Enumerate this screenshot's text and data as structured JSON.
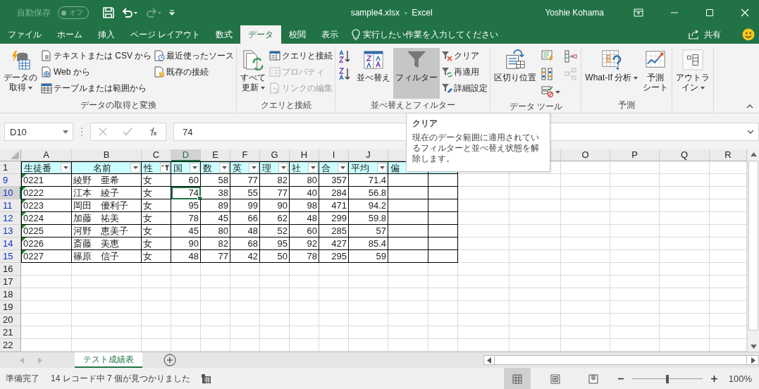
{
  "title_bar": {
    "autosave_label": "自動保存",
    "autosave_toggle": {
      "text": "オフ",
      "on": false
    },
    "title": "sample4.xlsx  -  Excel",
    "user": "Yoshie Kohama"
  },
  "ribbon_tabs": [
    {
      "label": "ファイル",
      "selected": false
    },
    {
      "label": "ホーム",
      "selected": false
    },
    {
      "label": "挿入",
      "selected": false
    },
    {
      "label": "ページ レイアウト",
      "selected": false
    },
    {
      "label": "数式",
      "selected": false
    },
    {
      "label": "データ",
      "selected": true
    },
    {
      "label": "校閲",
      "selected": false
    },
    {
      "label": "表示",
      "selected": false
    }
  ],
  "tell_me": "実行したい作業を入力してください",
  "share": "共有",
  "ribbon_groups": [
    {
      "label": "データの取得と変換",
      "columns": [
        [
          {
            "kind": "large",
            "lines": [
              "データの",
              "取得"
            ],
            "dropdown": true,
            "disabled": false
          }
        ],
        [
          {
            "kind": "small",
            "label": "テキストまたは CSV から",
            "disabled": false
          },
          {
            "kind": "small",
            "label": "Web から",
            "disabled": false
          },
          {
            "kind": "small",
            "label": "テーブルまたは範囲から",
            "disabled": false
          }
        ],
        [
          {
            "kind": "small",
            "label": "最近使ったソース",
            "disabled": false
          },
          {
            "kind": "small",
            "label": "既存の接続",
            "disabled": false
          }
        ]
      ]
    },
    {
      "label": "クエリと接続",
      "columns": [
        [
          {
            "kind": "large",
            "lines": [
              "すべて",
              "更新"
            ],
            "dropdown": true,
            "disabled": false
          }
        ],
        [
          {
            "kind": "small",
            "label": "クエリと接続",
            "disabled": false
          },
          {
            "kind": "small",
            "label": "プロパティ",
            "disabled": true
          },
          {
            "kind": "small",
            "label": "リンクの編集",
            "disabled": true
          }
        ]
      ]
    },
    {
      "label": "並べ替えとフィルター",
      "columns": [
        [
          {
            "kind": "icon",
            "disabled": false
          },
          {
            "kind": "icon",
            "disabled": false
          }
        ],
        [
          {
            "kind": "large",
            "lines": [
              "並べ替え"
            ],
            "dropdown": false,
            "disabled": false
          }
        ],
        [
          {
            "kind": "large",
            "lines": [
              "フィルター"
            ],
            "dropdown": false,
            "disabled": false,
            "pressed": true
          }
        ],
        [
          {
            "kind": "small",
            "label": "クリア",
            "disabled": false
          },
          {
            "kind": "small",
            "label": "再適用",
            "disabled": false
          },
          {
            "kind": "small",
            "label": "詳細設定",
            "disabled": false
          }
        ]
      ]
    },
    {
      "label": "データ ツール",
      "columns": [
        [
          {
            "kind": "large",
            "lines": [
              "区切り位置"
            ],
            "dropdown": false,
            "disabled": false
          }
        ],
        [
          {
            "kind": "icon",
            "disabled": false
          },
          {
            "kind": "icon",
            "disabled": false
          },
          {
            "kind": "icon",
            "disabled": false
          }
        ],
        [
          {
            "kind": "icon",
            "disabled": false
          },
          {
            "kind": "icon",
            "disabled": true
          }
        ]
      ]
    },
    {
      "label": "予測",
      "columns": [
        [
          {
            "kind": "large",
            "lines": [
              "What-If 分析"
            ],
            "dropdown": true,
            "disabled": false
          }
        ],
        [
          {
            "kind": "large",
            "lines": [
              "予測",
              "シート"
            ],
            "dropdown": false,
            "disabled": false
          }
        ]
      ]
    },
    {
      "columns": [
        [
          {
            "kind": "large",
            "lines": [
              "アウトラ",
              "イン"
            ],
            "dropdown": true,
            "disabled": false
          }
        ]
      ]
    }
  ],
  "name_box": "D10",
  "formula": "74",
  "tooltip": {
    "title": "クリア",
    "text": "現在のデータ範囲に適用されているフィルターと並べ替え状態を解除します。"
  },
  "columns": [
    {
      "letter": "A",
      "selected": false
    },
    {
      "letter": "B",
      "selected": false
    },
    {
      "letter": "C",
      "selected": false
    },
    {
      "letter": "D",
      "selected": true
    },
    {
      "letter": "E",
      "selected": false
    },
    {
      "letter": "F",
      "selected": false
    },
    {
      "letter": "G",
      "selected": false
    },
    {
      "letter": "H",
      "selected": false
    },
    {
      "letter": "I",
      "selected": false
    },
    {
      "letter": "J",
      "selected": false
    }
  ],
  "columns_right": [
    {
      "letter": "O",
      "selected": false
    },
    {
      "letter": "P",
      "selected": false
    },
    {
      "letter": "Q",
      "selected": false
    },
    {
      "letter": "R",
      "selected": false
    }
  ],
  "header_row": {
    "number": "1",
    "cells": [
      {
        "text": "生徒番",
        "kind": "text",
        "filtered": false
      },
      {
        "text": "名前",
        "kind": "text",
        "filtered": false
      },
      {
        "text": "性",
        "kind": "text",
        "filtered": true
      },
      {
        "text": "国",
        "kind": "number",
        "filtered": false
      },
      {
        "text": "数",
        "kind": "number",
        "filtered": false
      },
      {
        "text": "英",
        "kind": "number",
        "filtered": false
      },
      {
        "text": "理",
        "kind": "number",
        "filtered": false
      },
      {
        "text": "社",
        "kind": "number",
        "filtered": false
      },
      {
        "text": "合",
        "kind": "number",
        "filtered": false
      },
      {
        "text": "平均",
        "kind": "number",
        "filtered": false
      },
      {
        "text": "偏"
      }
    ]
  },
  "rows": [
    {
      "number": "9",
      "filtered": true,
      "selected": false,
      "flagged": true,
      "cells": [
        {
          "text": "0221",
          "selected": false
        },
        {
          "text": "綾野　亜希",
          "selected": false
        },
        {
          "text": "女",
          "selected": false
        },
        {
          "text": "60",
          "selected": false
        },
        {
          "text": "58",
          "selected": false
        },
        {
          "text": "77",
          "selected": false
        },
        {
          "text": "82",
          "selected": false
        },
        {
          "text": "80",
          "selected": false
        },
        {
          "text": "357",
          "selected": false
        },
        {
          "text": "71.4",
          "selected": false
        }
      ]
    },
    {
      "number": "10",
      "filtered": true,
      "selected": true,
      "flagged": true,
      "cells": [
        {
          "text": "0222",
          "selected": false
        },
        {
          "text": "江本　綾子",
          "selected": false
        },
        {
          "text": "女",
          "selected": false
        },
        {
          "text": "74",
          "selected": true
        },
        {
          "text": "38",
          "selected": false
        },
        {
          "text": "55",
          "selected": false
        },
        {
          "text": "77",
          "selected": false
        },
        {
          "text": "40",
          "selected": false
        },
        {
          "text": "284",
          "selected": false
        },
        {
          "text": "56.8",
          "selected": false
        }
      ]
    },
    {
      "number": "11",
      "filtered": true,
      "selected": false,
      "flagged": true,
      "cells": [
        {
          "text": "0223",
          "selected": false
        },
        {
          "text": "岡田　優利子",
          "selected": false
        },
        {
          "text": "女",
          "selected": false
        },
        {
          "text": "95",
          "selected": false
        },
        {
          "text": "89",
          "selected": false
        },
        {
          "text": "99",
          "selected": false
        },
        {
          "text": "90",
          "selected": false
        },
        {
          "text": "98",
          "selected": false
        },
        {
          "text": "471",
          "selected": false
        },
        {
          "text": "94.2",
          "selected": false
        }
      ]
    },
    {
      "number": "12",
      "filtered": true,
      "selected": false,
      "flagged": true,
      "cells": [
        {
          "text": "0224",
          "selected": false
        },
        {
          "text": "加藤　祐美",
          "selected": false
        },
        {
          "text": "女",
          "selected": false
        },
        {
          "text": "78",
          "selected": false
        },
        {
          "text": "45",
          "selected": false
        },
        {
          "text": "66",
          "selected": false
        },
        {
          "text": "62",
          "selected": false
        },
        {
          "text": "48",
          "selected": false
        },
        {
          "text": "299",
          "selected": false
        },
        {
          "text": "59.8",
          "selected": false
        }
      ]
    },
    {
      "number": "13",
      "filtered": true,
      "selected": false,
      "flagged": true,
      "cells": [
        {
          "text": "0225",
          "selected": false
        },
        {
          "text": "河野　恵美子",
          "selected": false
        },
        {
          "text": "女",
          "selected": false
        },
        {
          "text": "45",
          "selected": false
        },
        {
          "text": "80",
          "selected": false
        },
        {
          "text": "48",
          "selected": false
        },
        {
          "text": "52",
          "selected": false
        },
        {
          "text": "60",
          "selected": false
        },
        {
          "text": "285",
          "selected": false
        },
        {
          "text": "57",
          "selected": false
        }
      ]
    },
    {
      "number": "14",
      "filtered": true,
      "selected": false,
      "flagged": true,
      "cells": [
        {
          "text": "0226",
          "selected": false
        },
        {
          "text": "斎藤　美恵",
          "selected": false
        },
        {
          "text": "女",
          "selected": false
        },
        {
          "text": "90",
          "selected": false
        },
        {
          "text": "82",
          "selected": false
        },
        {
          "text": "68",
          "selected": false
        },
        {
          "text": "95",
          "selected": false
        },
        {
          "text": "92",
          "selected": false
        },
        {
          "text": "427",
          "selected": false
        },
        {
          "text": "85.4",
          "selected": false
        }
      ]
    },
    {
      "number": "15",
      "filtered": true,
      "selected": false,
      "flagged": true,
      "cells": [
        {
          "text": "0227",
          "selected": false
        },
        {
          "text": "篠原　信子",
          "selected": false
        },
        {
          "text": "女",
          "selected": false
        },
        {
          "text": "48",
          "selected": false
        },
        {
          "text": "77",
          "selected": false
        },
        {
          "text": "42",
          "selected": false
        },
        {
          "text": "50",
          "selected": false
        },
        {
          "text": "78",
          "selected": false
        },
        {
          "text": "295",
          "selected": false
        },
        {
          "text": "59",
          "selected": false
        }
      ]
    },
    {
      "number": "16",
      "filtered": false,
      "selected": false,
      "cells": []
    },
    {
      "number": "17",
      "filtered": false,
      "selected": false,
      "cells": []
    },
    {
      "number": "18",
      "filtered": false,
      "selected": false,
      "cells": []
    },
    {
      "number": "19",
      "filtered": false,
      "selected": false,
      "cells": []
    },
    {
      "number": "20",
      "filtered": false,
      "selected": false,
      "cells": []
    },
    {
      "number": "21",
      "filtered": false,
      "selected": false,
      "cells": []
    },
    {
      "number": "22",
      "filtered": false,
      "selected": false,
      "cells": []
    }
  ],
  "sheet_tabs": [
    {
      "label": "テスト成績表",
      "selected": true
    }
  ],
  "status_bar": {
    "ready": "準備完了",
    "message": "14 レコード中 7 個が見つかりました",
    "views": [
      {
        "kind": "normal",
        "selected": true
      },
      {
        "kind": "layout",
        "selected": false
      },
      {
        "kind": "pagebreak",
        "selected": false
      }
    ],
    "zoom": {
      "level": 0.5,
      "text": "100%"
    }
  }
}
